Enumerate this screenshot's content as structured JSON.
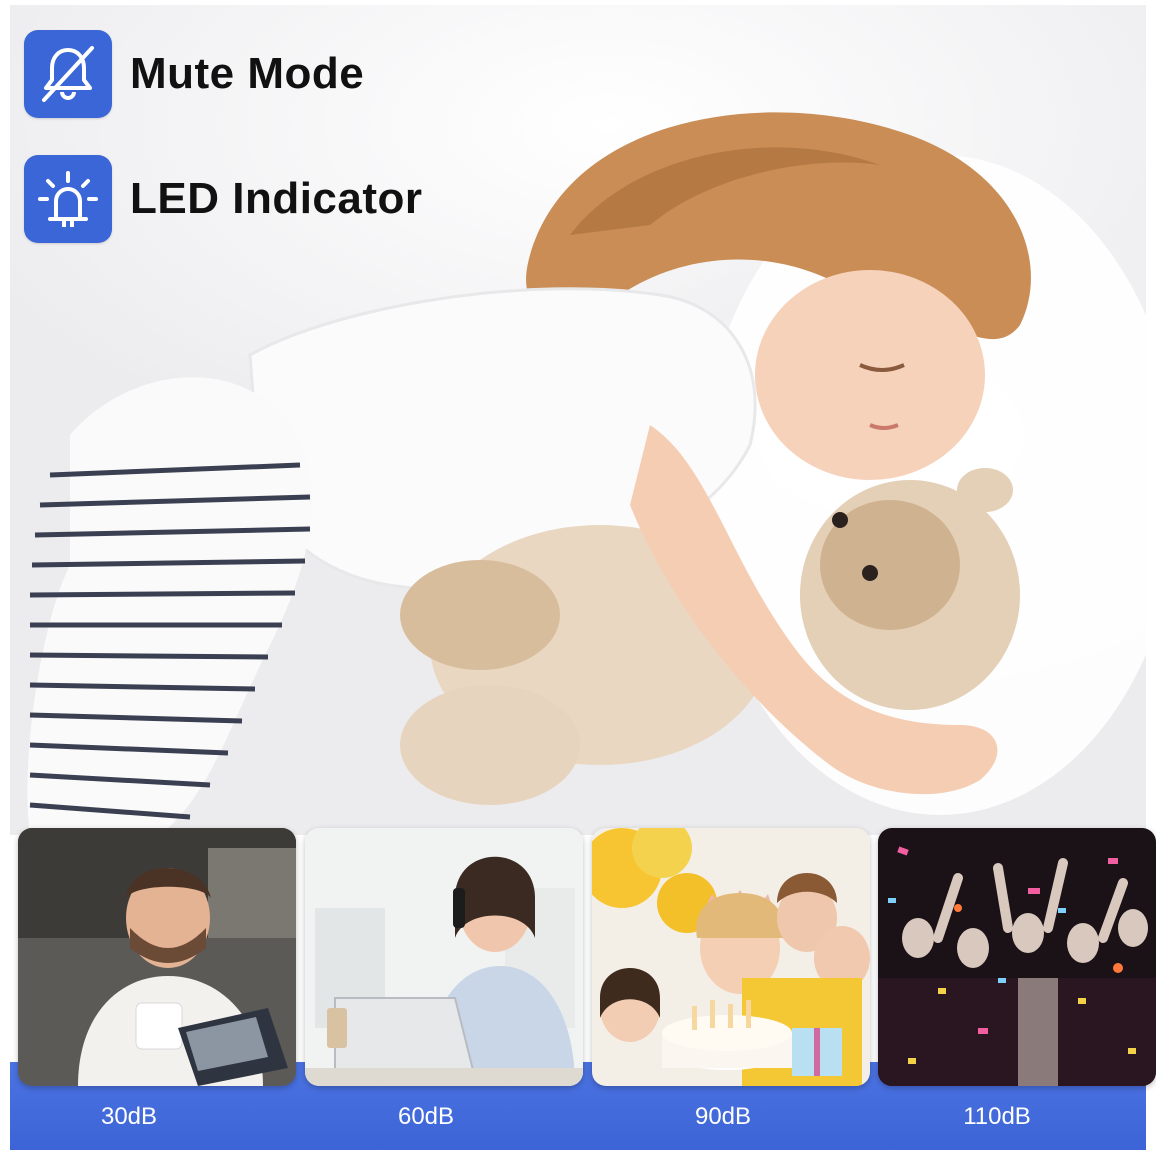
{
  "features": [
    {
      "label": "Mute Mode",
      "icon": "bell-muted-icon"
    },
    {
      "label": "LED Indicator",
      "icon": "alarm-light-icon"
    }
  ],
  "colors": {
    "accent": "#3a66d8",
    "band": "#4068d8",
    "label_text": "#111111",
    "db_text": "#ffffff"
  },
  "noise_levels": [
    {
      "label": "30dB"
    },
    {
      "label": "60dB"
    },
    {
      "label": "90dB"
    },
    {
      "label": "110dB"
    }
  ]
}
